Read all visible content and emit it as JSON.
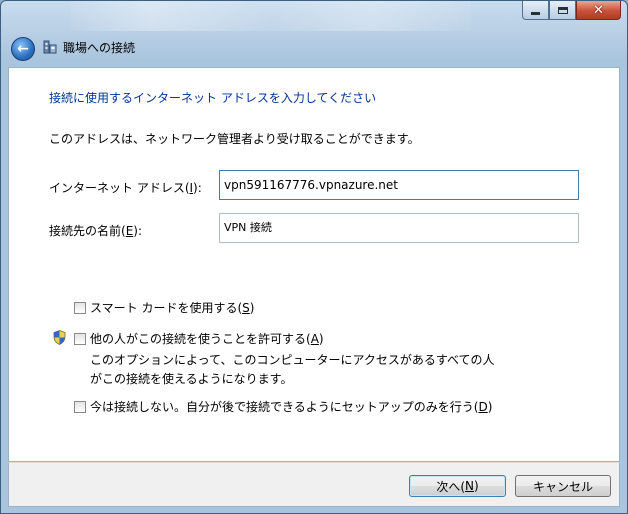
{
  "window": {
    "title": "職場への接続",
    "close_glyph": "✕"
  },
  "page": {
    "heading": "接続に使用するインターネット アドレスを入力してください",
    "info": "このアドレスは、ネットワーク管理者より受け取ることができます。"
  },
  "form": {
    "address_label": "インターネット アドレス(",
    "address_key": "I",
    "address_label_end": "):",
    "address_value": "vpn591167776.vpnazure.net",
    "name_label": "接続先の名前(",
    "name_key": "E",
    "name_label_end": "):",
    "name_value": "VPN 接続"
  },
  "options": {
    "smartcard_label": "スマート カードを使用する(",
    "smartcard_key": "S",
    "smartcard_end": ")",
    "allow_label": "他の人がこの接続を使うことを許可する(",
    "allow_key": "A",
    "allow_end": ")",
    "allow_desc_line1": "このオプションによって、このコンピューターにアクセスがあるすべての人",
    "allow_desc_line2": "がこの接続を使えるようになります。",
    "dont_connect_label": "今は接続しない。自分が後で接続できるようにセットアップのみを行う(",
    "dont_connect_key": "D",
    "dont_connect_end": ")"
  },
  "buttons": {
    "next_label": "次へ(",
    "next_key": "N",
    "next_end": ")",
    "cancel_label": "キャンセル"
  },
  "colors": {
    "heading": "#003399",
    "accent": "#3c7fb1"
  }
}
